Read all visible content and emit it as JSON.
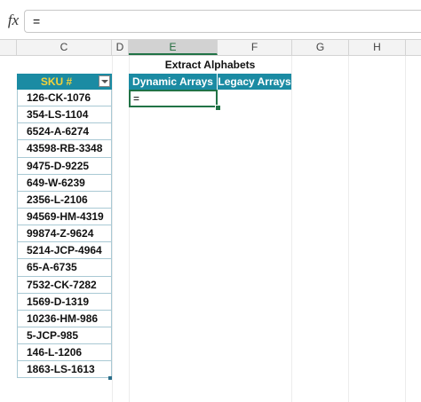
{
  "formula_bar": {
    "fx_label": "fx",
    "value": "="
  },
  "columns": [
    "C",
    "D",
    "E",
    "F",
    "G",
    "H"
  ],
  "sku_table": {
    "header": "SKU #",
    "rows": [
      "126-CK-1076",
      "354-LS-1104",
      "6524-A-6274",
      "43598-RB-3348",
      "9475-D-9225",
      "649-W-6239",
      "2356-L-2106",
      "94569-HM-4319",
      "99874-Z-9624",
      "5214-JCP-4964",
      "65-A-6735",
      "7532-CK-7282",
      "1569-D-1319",
      "10236-HM-986",
      "5-JCP-985",
      "146-L-1206",
      "1863-LS-1613"
    ]
  },
  "output_table": {
    "title": "Extract Alphabets",
    "header_dynamic": "Dynamic Arrays",
    "header_legacy": "Legacy Arrays",
    "active_cell_value": "="
  },
  "colors": {
    "table_header": "#1b8ba3",
    "sku_header_text": "#f3d23a",
    "selection": "#217346"
  }
}
